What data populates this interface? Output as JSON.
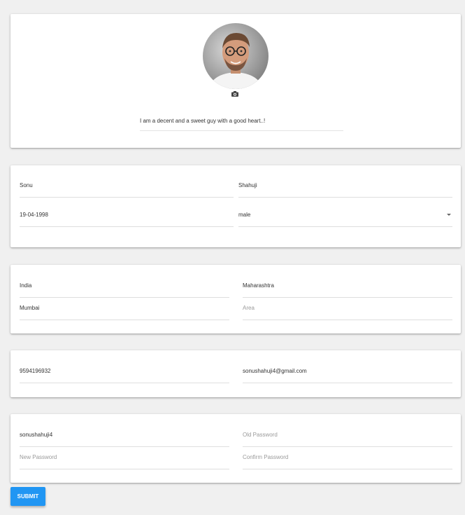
{
  "profile": {
    "bio": "I am a decent and a sweet guy with a good heart..!",
    "camera_icon": "camera-icon"
  },
  "personal": {
    "first_name": "Sonu",
    "last_name": "Shahuji",
    "dob": "19-04-1998",
    "gender": "male"
  },
  "address": {
    "country": "India",
    "state": "Maharashtra",
    "city": "Mumbai",
    "area_placeholder": "Area"
  },
  "contact": {
    "phone": "9594196932",
    "email": "sonushahuji4@gmail.com"
  },
  "account": {
    "username": "sonushahuji4",
    "old_password_placeholder": "Old Password",
    "new_password_placeholder": "New Password",
    "confirm_password_placeholder": "Confirm Password"
  },
  "actions": {
    "submit_label": "SUBMIT"
  },
  "colors": {
    "background": "#f0f0f0",
    "accent": "#2196f3"
  }
}
